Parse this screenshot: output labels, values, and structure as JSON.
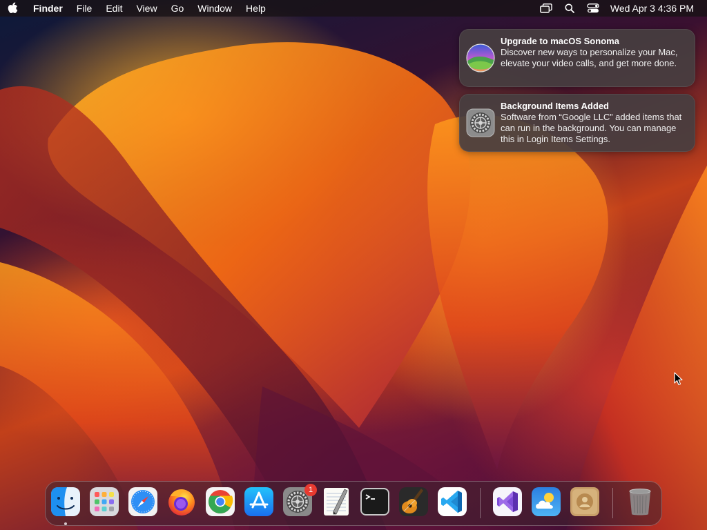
{
  "menubar": {
    "apple_icon": "apple-logo-icon",
    "app_name": "Finder",
    "menus": [
      "File",
      "Edit",
      "View",
      "Go",
      "Window",
      "Help"
    ],
    "status_icons": [
      "screen-mirroring-icon",
      "spotlight-search-icon",
      "control-center-icon"
    ],
    "clock": "Wed Apr 3  4:36 PM"
  },
  "notifications": [
    {
      "icon": "macos-sonoma-icon",
      "title": "Upgrade to macOS Sonoma",
      "body": "Discover new ways to personalize your Mac, elevate your video calls, and get more done."
    },
    {
      "icon": "system-settings-icon",
      "title": "Background Items Added",
      "body": "Software from “Google LLC” added items that can run in the background. You can manage this in Login Items Settings."
    }
  ],
  "dock": {
    "apps": [
      {
        "name": "Finder",
        "icon": "finder-icon",
        "running": true
      },
      {
        "name": "Launchpad",
        "icon": "launchpad-icon"
      },
      {
        "name": "Safari",
        "icon": "safari-icon"
      },
      {
        "name": "Firefox",
        "icon": "firefox-icon"
      },
      {
        "name": "Google Chrome",
        "icon": "chrome-icon"
      },
      {
        "name": "App Store",
        "icon": "app-store-icon"
      },
      {
        "name": "System Settings",
        "icon": "system-settings-icon",
        "badge": "1"
      },
      {
        "name": "TextEdit",
        "icon": "textedit-icon"
      },
      {
        "name": "Terminal",
        "icon": "terminal-icon"
      },
      {
        "name": "GarageBand",
        "icon": "garageband-icon"
      },
      {
        "name": "Visual Studio Code",
        "icon": "vscode-icon"
      },
      {
        "name": "Visual Studio",
        "icon": "visual-studio-icon"
      },
      {
        "name": "Weather",
        "icon": "weather-icon"
      },
      {
        "name": "Contacts",
        "icon": "contacts-icon"
      },
      {
        "name": "Trash",
        "icon": "trash-icon"
      }
    ]
  },
  "colors": {
    "badge": "#e83a30",
    "wallpaper_orange": "#f07a18",
    "wallpaper_purple": "#5a1238"
  }
}
